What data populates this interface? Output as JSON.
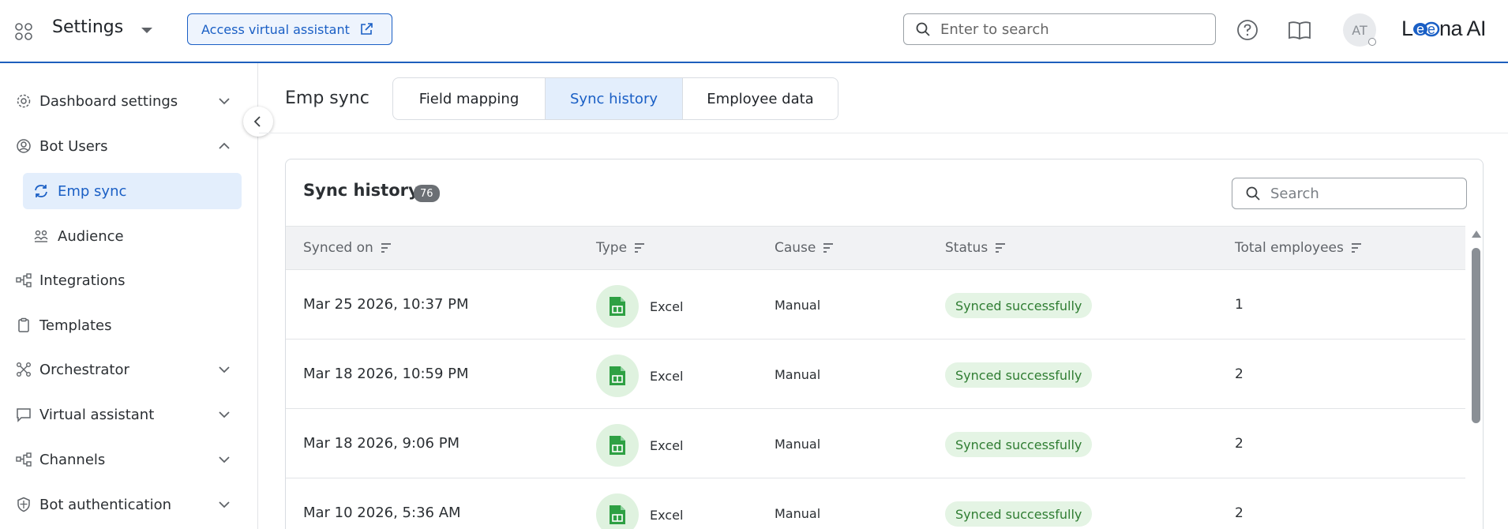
{
  "header": {
    "app_title": "Settings",
    "assist_button_label": "Access virtual assistant",
    "search_placeholder": "Enter to search",
    "avatar_initials": "AT",
    "logo_text": "Leena AI"
  },
  "sidebar": {
    "items": [
      {
        "label": "Dashboard settings",
        "icon": "gear-icon",
        "expandable": true,
        "expanded": false
      },
      {
        "label": "Bot Users",
        "icon": "user-circle-icon",
        "expandable": true,
        "expanded": true
      },
      {
        "label": "Emp sync",
        "icon": "sync-icon",
        "sub": true,
        "active": true
      },
      {
        "label": "Audience",
        "icon": "group-icon",
        "sub": true
      },
      {
        "label": "Integrations",
        "icon": "integrations-icon",
        "expandable": false
      },
      {
        "label": "Templates",
        "icon": "clipboard-icon",
        "expandable": false
      },
      {
        "label": "Orchestrator",
        "icon": "orchestrator-icon",
        "expandable": true,
        "expanded": false
      },
      {
        "label": "Virtual assistant",
        "icon": "chat-icon",
        "expandable": true,
        "expanded": false
      },
      {
        "label": "Channels",
        "icon": "channels-icon",
        "expandable": true,
        "expanded": false
      },
      {
        "label": "Bot authentication",
        "icon": "shield-icon",
        "expandable": true,
        "expanded": false
      }
    ]
  },
  "main": {
    "page_title": "Emp sync",
    "tabs": [
      {
        "label": "Field mapping",
        "active": false
      },
      {
        "label": "Sync history",
        "active": true
      },
      {
        "label": "Employee data",
        "active": false
      }
    ],
    "card": {
      "title": "Sync history",
      "count": "76",
      "search_placeholder": "Search",
      "columns": [
        "Synced on",
        "Type",
        "Cause",
        "Status",
        "Total employees"
      ],
      "rows": [
        {
          "synced_on": "Mar 25 2026, 10:37 PM",
          "type": "Excel",
          "cause": "Manual",
          "status": "Synced successfully",
          "total": "1"
        },
        {
          "synced_on": "Mar 18 2026, 10:59 PM",
          "type": "Excel",
          "cause": "Manual",
          "status": "Synced successfully",
          "total": "2"
        },
        {
          "synced_on": "Mar 18 2026, 9:06 PM",
          "type": "Excel",
          "cause": "Manual",
          "status": "Synced successfully",
          "total": "2"
        },
        {
          "synced_on": "Mar 10 2026, 5:36 AM",
          "type": "Excel",
          "cause": "Manual",
          "status": "Synced successfully",
          "total": "2"
        }
      ]
    }
  },
  "colors": {
    "accent": "#1a5fc5",
    "active_bg": "#e3eefc",
    "success_text": "#2f7d32",
    "success_bg": "#e4f4e4",
    "excel_green": "#2ea043"
  }
}
